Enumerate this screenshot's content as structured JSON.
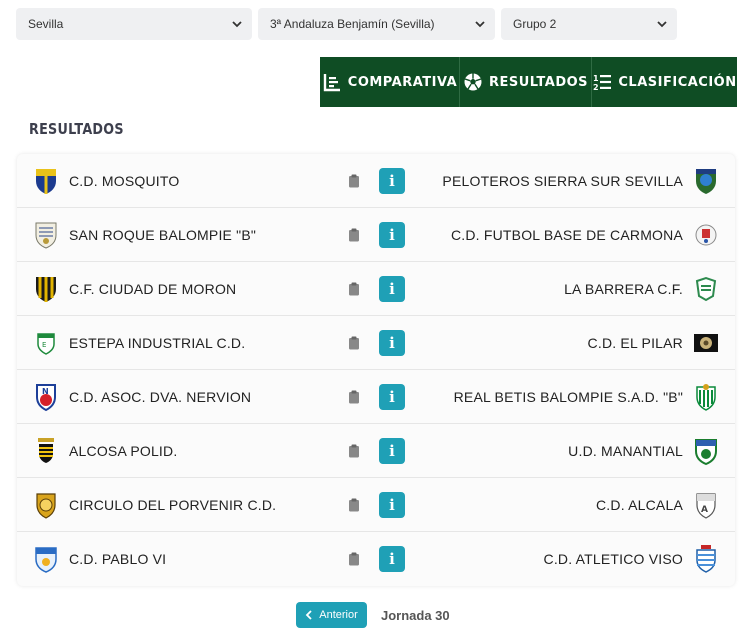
{
  "filters": {
    "province": "Sevilla",
    "competition": "3ª Andaluza Benjamín (Sevilla)",
    "group": "Grupo 2"
  },
  "nav": {
    "comparativa": "Comparativa",
    "resultados": "Resultados",
    "clasificacion": "Clasificación"
  },
  "section_title": "Resultados",
  "matches": [
    {
      "home": "C.D. MOSQUITO",
      "away": "PELOTEROS SIERRA SUR SEVILLA",
      "info": "i"
    },
    {
      "home": "SAN ROQUE BALOMPIE \"B\"",
      "away": "C.D. FUTBOL BASE DE CARMONA",
      "info": "i"
    },
    {
      "home": "C.F. CIUDAD DE MORON",
      "away": "LA BARRERA C.F.",
      "info": "i"
    },
    {
      "home": "ESTEPA INDUSTRIAL C.D.",
      "away": "C.D. EL PILAR",
      "info": "i"
    },
    {
      "home": "C.D. ASOC. DVA. NERVION",
      "away": "REAL BETIS BALOMPIE S.A.D. \"B\"",
      "info": "i"
    },
    {
      "home": "ALCOSA POLID.",
      "away": "U.D. MANANTIAL",
      "info": "i"
    },
    {
      "home": "CIRCULO DEL PORVENIR C.D.",
      "away": "C.D. ALCALA",
      "info": "i"
    },
    {
      "home": "C.D. PABLO VI",
      "away": "C.D. ATLETICO VISO",
      "info": "i"
    }
  ],
  "pager": {
    "prev_label": "Anterior",
    "jornada": "Jornada 30"
  },
  "colors": {
    "nav_bg": "#0f4d24",
    "info_btn": "#1fa0b6",
    "select_bg": "#eff0f2"
  }
}
